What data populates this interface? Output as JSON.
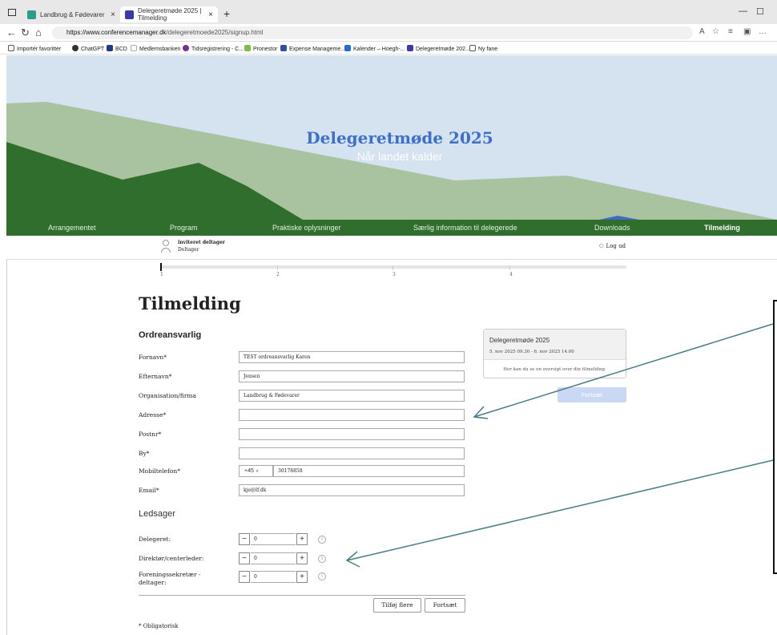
{
  "browser": {
    "tabs": [
      {
        "label": "Landbrug & Fødevarer",
        "active": false
      },
      {
        "label": "Delegeretmøde 2025 | Tilmelding",
        "active": true
      }
    ],
    "url_host": "https://www.conferencemanager.dk",
    "url_path": "/delegeretmoede2025/signup.html",
    "bookmarks": [
      "Importér favoritter",
      "ChatGPT",
      "BCD",
      "Medlemsbanken",
      "Tidsregistrering - C...",
      "Pronestor",
      "Expense Manageme...",
      "Kalender – Hoegh-...",
      "Delegeretmøde 202...",
      "Ny fane"
    ]
  },
  "hero": {
    "title": "Delegeretmøde 2025",
    "subtitle": "Når landet kalder"
  },
  "nav": {
    "items": [
      "Arrangementet",
      "Program",
      "Praktiske oplysninger",
      "Særlig information til delegerede",
      "Downloads",
      "Tilmelding"
    ],
    "active": "Tilmelding"
  },
  "user": {
    "name": "inviteret deltager",
    "role": "Deltager",
    "logout": "Log ud"
  },
  "steps": {
    "labels": [
      "1",
      "2",
      "3",
      "4"
    ],
    "current": 1
  },
  "page": {
    "title": "Tilmelding",
    "section_orderer": "Ordreansvarlig",
    "section_companions": "Ledsager",
    "required_note": "* Obligatorisk"
  },
  "form": {
    "fornavn": {
      "label": "Fornavn*",
      "value": "TEST ordreansvarlig Karen"
    },
    "efternavn": {
      "label": "Efternavn*",
      "value": "Jensen"
    },
    "organisation": {
      "label": "Organisation/firma",
      "value": "Landbrug & Fødevarer"
    },
    "adresse": {
      "label": "Adresse*",
      "value": ""
    },
    "postnr": {
      "label": "Postnr*",
      "value": ""
    },
    "by": {
      "label": "By*",
      "value": ""
    },
    "mobil": {
      "label": "Mobiltelefon*",
      "country_code": "+45",
      "value": "30178858"
    },
    "email": {
      "label": "Email*",
      "value": "kje@lf.dk"
    }
  },
  "companions": [
    {
      "label": "Delegeret:",
      "value": "0"
    },
    {
      "label": "Direktør/centerleder:",
      "value": "0"
    },
    {
      "label": "Foreningssekretær - deltager:",
      "value": "0"
    }
  ],
  "buttons": {
    "add_more": "Tilføj flere",
    "continue": "Fortsæt",
    "continue_summary": "Fortsæt"
  },
  "summary": {
    "title": "Delegeretmøde 2025",
    "dates": "5. nov 2025 09.30 - 6. nov 2025 14.00",
    "body": "Her kan du se en oversigt over din tilmelding."
  },
  "colors": {
    "nav_green": "#2f6e2d",
    "hero_sky": "#d5e2f0",
    "title_blue": "#3e6fc9",
    "annotation_arrow": "#4a7a86"
  }
}
